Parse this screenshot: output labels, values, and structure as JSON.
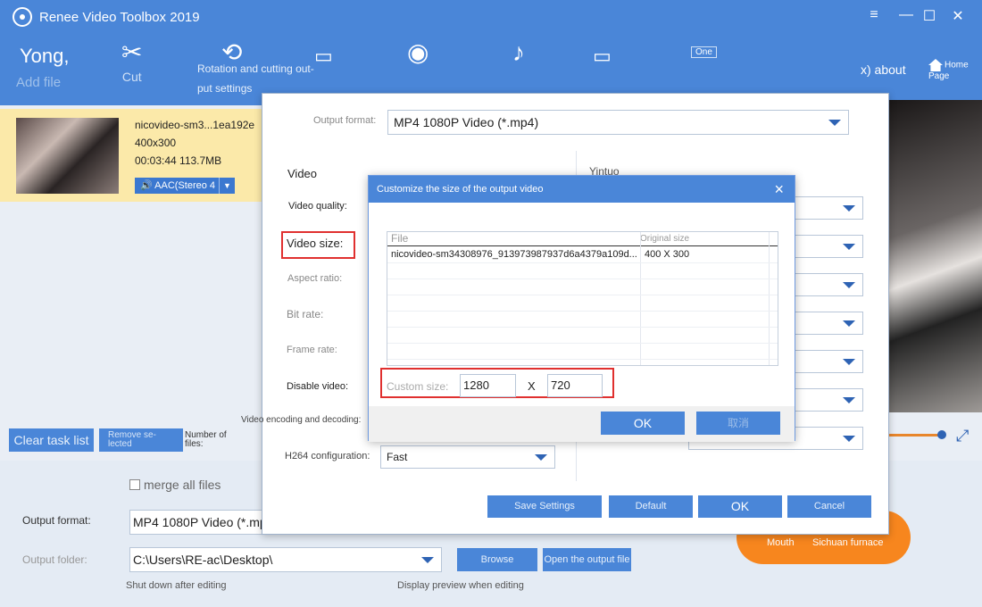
{
  "window": {
    "title": "Renee Video Toolbox 2019",
    "controls": {
      "menu": "≡",
      "minimize": "—",
      "maximize": "☐",
      "close": "✕"
    }
  },
  "toolbar": {
    "user": "Yong,",
    "add_file": "Add file",
    "cut_label": "Cut",
    "rotate_hint_line1": "Rotation and cutting out-",
    "rotate_hint_line2": "put settings",
    "one_badge": "One",
    "about": "x) about",
    "home": "Home Page"
  },
  "task": {
    "name": "nicovideo-sm3...1ea192e",
    "resolution": "400x300",
    "meta": "00:03:44 113.7MB",
    "audio": "AAC(Stereo 4"
  },
  "left_controls": {
    "clear_task_list": "Clear task list",
    "remove_selected": "Remove se-lected",
    "number_of_files": "Number of files:"
  },
  "bottom": {
    "merge": "merge all files",
    "output_format_label": "Output format:",
    "output_format_value": "MP4 1080P Video (*.mp",
    "output_folder_label": "Output folder:",
    "output_folder_value": "C:\\Users\\RE-ac\\Desktop\\",
    "browse": "Browse",
    "open_output": "Open the output file",
    "shutdown": "Shut down after editing",
    "display_preview": "Display preview when editing",
    "orange_left": "Mouth",
    "orange_right": "Sichuan furnace"
  },
  "settings": {
    "output_format_label": "Output format:",
    "output_format_value": "MP4 1080P Video (*.mp4)",
    "video_header": "Video",
    "right_header": "Yintuo",
    "video_quality": "Video quality:",
    "video_size": "Video size:",
    "aspect_ratio": "Aspect ratio:",
    "bit_rate": "Bit rate:",
    "frame_rate": "Frame rate:",
    "disable_video": "Disable video:",
    "encoding": "Video encoding and decoding:",
    "h264": "H264 configuration:",
    "h264_value": "Fast",
    "save_settings": "Save Settings",
    "default": "Default",
    "ok": "OK",
    "cancel": "Cancel"
  },
  "custom": {
    "title": "Customize the size of the output video",
    "col_file": "File",
    "col_original": "Original size",
    "rows": [
      {
        "file": "nicovideo-sm34308976_913973987937d6a4379a109d...",
        "size": "400 X 300"
      }
    ],
    "custom_size_label": "Custom size:",
    "width": "1280",
    "x": "X",
    "height": "720",
    "ok": "OK",
    "cancel": "取消"
  },
  "colors": {
    "accent": "#4a86d8",
    "highlight": "#e0302f",
    "orange": "#f7861e",
    "task_bg": "#fbe9a9"
  }
}
